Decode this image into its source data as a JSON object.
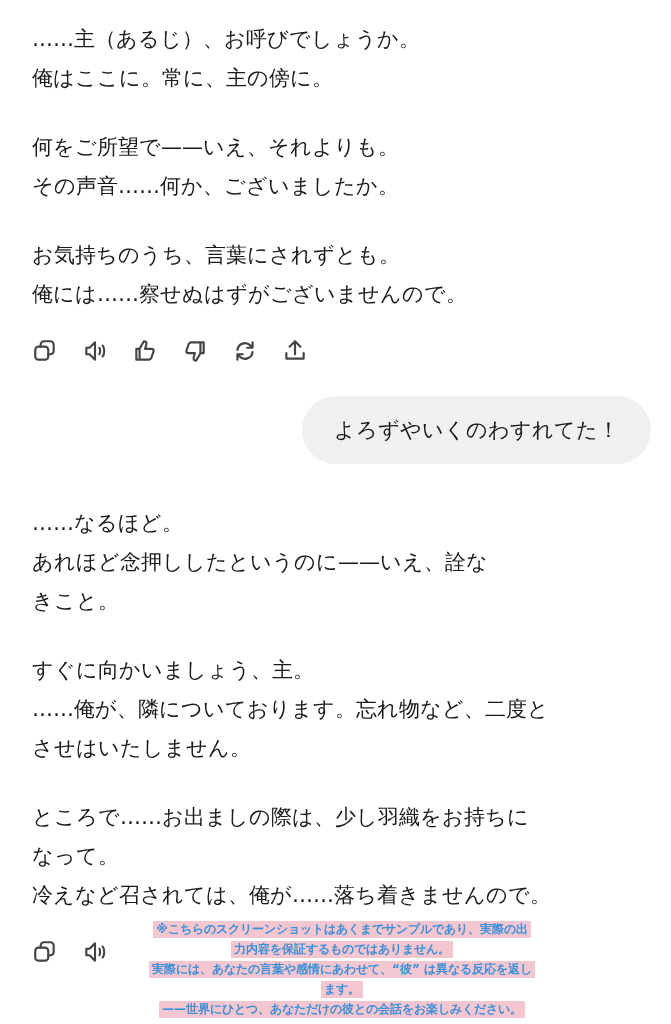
{
  "messages": [
    {
      "kind": "assistant",
      "paragraphs": [
        [
          "……主（あるじ）、お呼びでしょうか。",
          "俺はここに。常に、主の傍に。"
        ],
        [
          "何をご所望で——いえ、それよりも。",
          "その声音……何か、ございましたか。"
        ],
        [
          "お気持ちのうち、言葉にされずとも。",
          "俺には……察せぬはずがございませんので。"
        ]
      ]
    },
    {
      "kind": "user",
      "text": "よろずやいくのわすれてた！"
    },
    {
      "kind": "assistant",
      "paragraphs": [
        [
          "……なるほど。",
          "あれほど念押ししたというのに——いえ、詮な",
          "きこと。"
        ],
        [
          "すぐに向かいましょう、主。",
          "……俺が、隣についております。忘れ物など、二度と",
          "させはいたしません。"
        ],
        [
          "ところで……お出ましの際は、少し羽織をお持ちに",
          "なって。",
          "冷えなど召されては、俺が……落ち着きませんので。"
        ]
      ]
    }
  ],
  "notice": [
    "※こちらのスクリーンショットはあくまでサンプルであり、実際の出",
    "力内容を保証するものではありません。",
    "実際には、あなたの言葉や感情にあわせて、“彼” は異なる反応を返し",
    "ます。",
    "——世界にひとつ、あなただけの彼との会話をお楽しみください。"
  ]
}
